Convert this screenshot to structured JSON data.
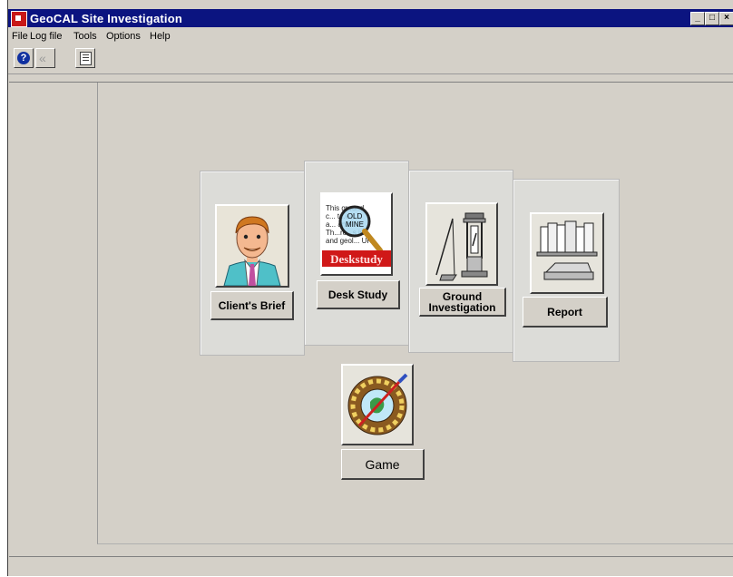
{
  "window": {
    "title": "GeoCAL Site Investigation",
    "controls": {
      "minimize": "_",
      "maximize": "□",
      "close": "×"
    }
  },
  "menu": [
    "File",
    "Log file",
    "Tools",
    "Options",
    "Help"
  ],
  "toolbar": {
    "help_icon": "question-icon",
    "back_icon": "back-icon",
    "list_icon": "list-icon"
  },
  "modules": {
    "clients_brief": {
      "label": "Client's Brief",
      "icon": "client-portrait-icon"
    },
    "desk_study": {
      "label": "Desk Study",
      "icon": "desk-study-icon",
      "icon_text": {
        "stamp": "OLD MINE",
        "banner": "Deskstudy",
        "lines": [
          "This ground",
          "c... t...e",
          "a...  and",
          "Th...ro...s in",
          "and geol... UK"
        ]
      }
    },
    "ground_investigation": {
      "label": "Ground\nInvestigation",
      "icon": "drilling-rig-icon"
    },
    "report": {
      "label": "Report",
      "icon": "report-books-icon"
    },
    "game": {
      "label": "Game",
      "icon": "dartboard-icon"
    }
  },
  "colors": {
    "titlebar": "#0b1480",
    "face": "#d4d0c8",
    "banner_red": "#d01818"
  }
}
